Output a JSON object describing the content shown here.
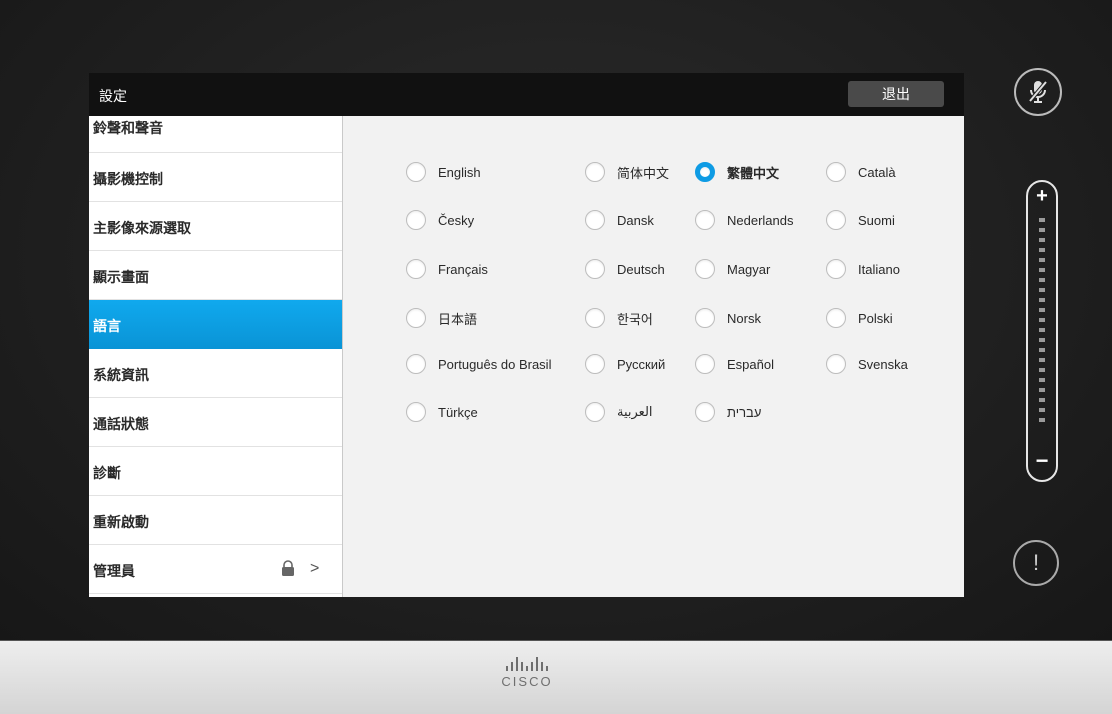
{
  "window": {
    "title": "設定",
    "exit_label": "退出"
  },
  "sidebar": {
    "items": [
      {
        "label": "鈴聲和聲音"
      },
      {
        "label": "攝影機控制"
      },
      {
        "label": "主影像來源選取"
      },
      {
        "label": "顯示畫面"
      },
      {
        "label": "語言",
        "active": true
      },
      {
        "label": "系統資訊"
      },
      {
        "label": "通話狀態"
      },
      {
        "label": "診斷"
      },
      {
        "label": "重新啟動"
      },
      {
        "label": "管理員",
        "icons": [
          "lock-icon",
          "chevron-right-icon"
        ]
      }
    ]
  },
  "languages": {
    "selected": "繁體中文",
    "rows": [
      [
        "English",
        "简体中文",
        "繁體中文",
        "Català"
      ],
      [
        "Česky",
        "Dansk",
        "Nederlands",
        "Suomi"
      ],
      [
        "Français",
        "Deutsch",
        "Magyar",
        "Italiano"
      ],
      [
        "日本語",
        "한국어",
        "Norsk",
        "Polski"
      ],
      [
        "Português do Brasil",
        "Русский",
        "Español",
        "Svenska"
      ],
      [
        "Türkçe",
        "العربية",
        "עברית"
      ]
    ]
  },
  "controls": {
    "mic_icon": "microphone-muted-icon",
    "volume_plus": "+",
    "volume_minus": "−",
    "alert_icon": "!"
  },
  "footer": {
    "logo_text": "CISCO"
  },
  "colors": {
    "accent": "#0e9be4",
    "titlebar": "#111111"
  }
}
